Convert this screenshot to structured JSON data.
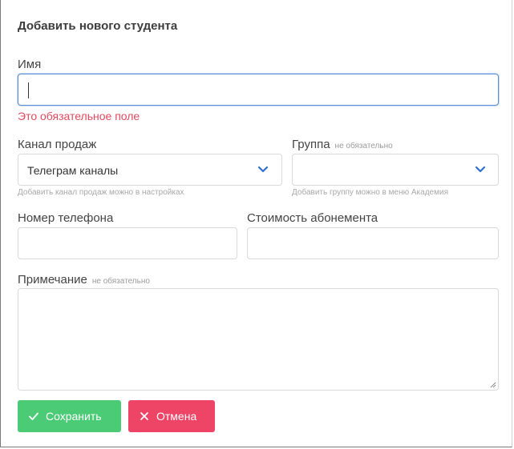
{
  "dialog": {
    "title": "Добавить нового студента"
  },
  "form": {
    "name": {
      "label": "Имя",
      "value": "",
      "error": "Это обязательное поле"
    },
    "sales_channel": {
      "label": "Канал продаж",
      "value": "Телеграм каналы",
      "help": "Добавить канал продаж можно в настройках"
    },
    "group": {
      "label": "Группа",
      "hint": "не обязательно",
      "value": "",
      "help": "Добавить группу можно в меню Академия"
    },
    "phone": {
      "label": "Номер телефона",
      "value": ""
    },
    "price": {
      "label": "Стоимость абонемента",
      "value": ""
    },
    "note": {
      "label": "Примечание",
      "hint": "не обязательно",
      "value": ""
    }
  },
  "buttons": {
    "save_label": "Сохранить",
    "cancel_label": "Отмена"
  },
  "colors": {
    "save": "#4ccb77",
    "cancel": "#ee4466",
    "error": "#e04a5f",
    "accent": "#2f6fd1"
  },
  "icons": {
    "save": "check-icon",
    "cancel": "close-icon",
    "select": "chevron-down-icon"
  }
}
